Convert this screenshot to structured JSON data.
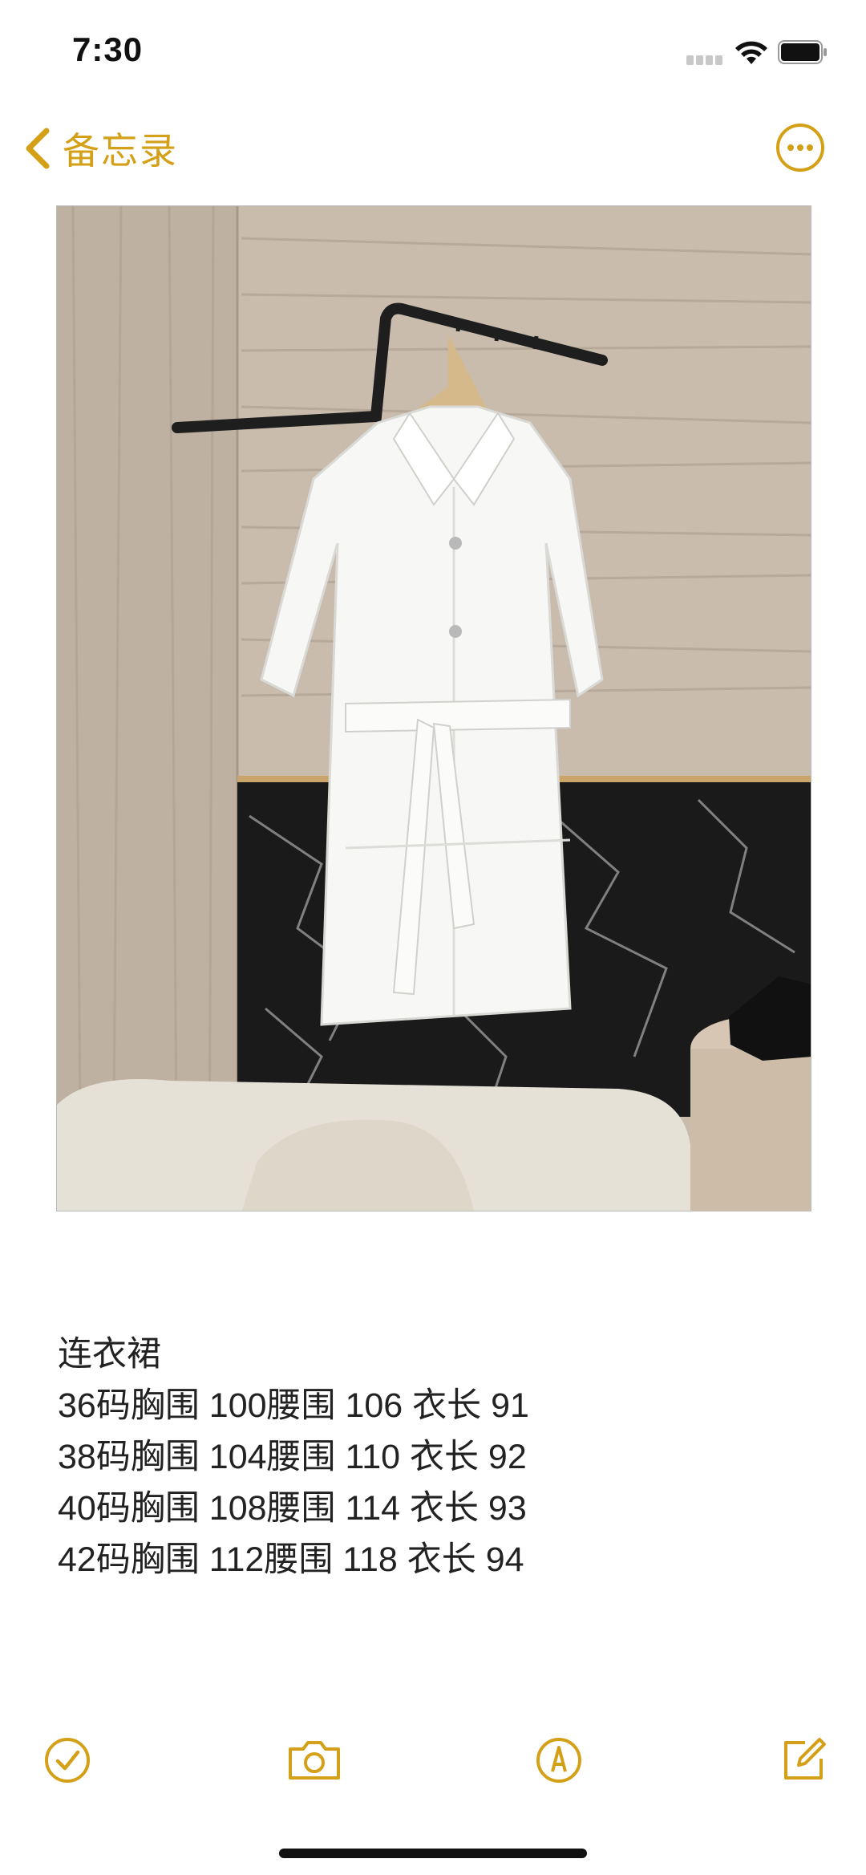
{
  "status_bar": {
    "time": "7:30"
  },
  "nav": {
    "back_label": "备忘录",
    "back_icon": "chevron-left-icon",
    "more_icon": "ellipsis-circle-icon"
  },
  "note": {
    "lines": [
      "连衣裙",
      "36码胸围 100腰围 106 衣长 91",
      "38码胸围 104腰围 110 衣长 92",
      "40码胸围 108腰围 114  衣长 93",
      "42码胸围 112腰围 118 衣长 94"
    ]
  },
  "toolbar": {
    "items": [
      "checklist-icon",
      "camera-icon",
      "markup-pen-icon",
      "compose-icon"
    ]
  },
  "colors": {
    "accent": "#D4A017",
    "text": "#222222"
  }
}
